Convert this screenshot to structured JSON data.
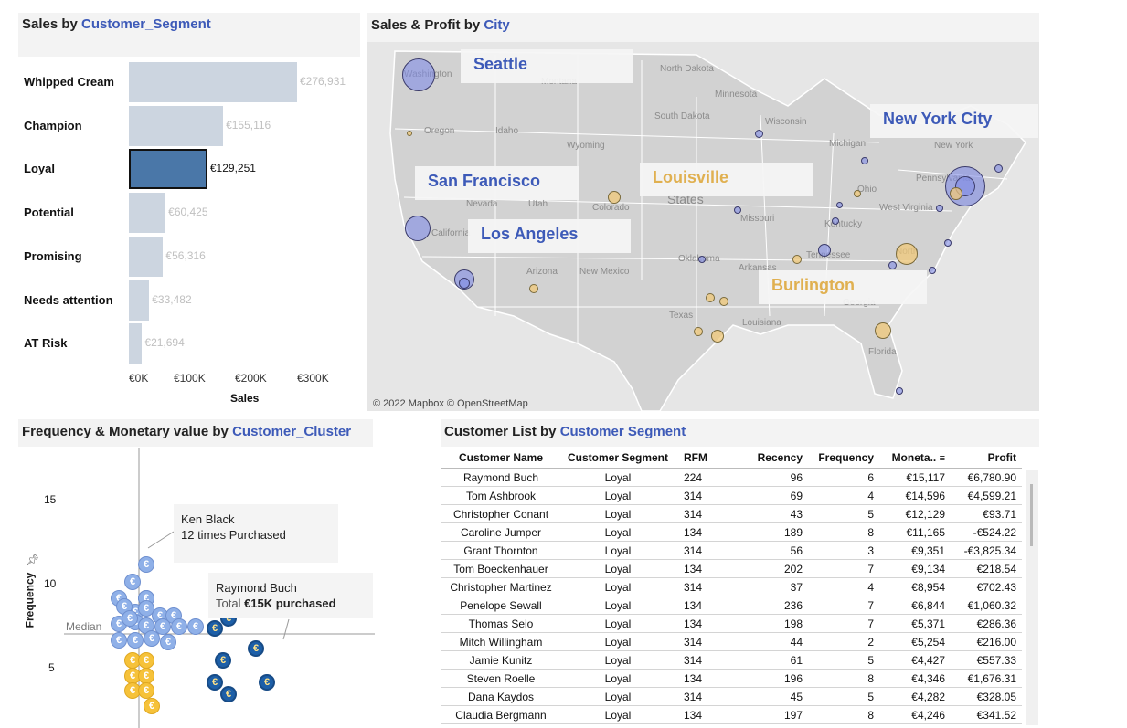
{
  "colors": {
    "accent": "#3d5ab8",
    "bar": "#ccd5e0",
    "bar_selected": "#4a77a8",
    "gold": "#e0b050",
    "coin_light": "#8fb0e8",
    "coin_dark": "#1d5fa8",
    "coin_gold": "#f6c23a"
  },
  "sales_panel": {
    "title_prefix": "Sales by ",
    "title_accent": "Customer_Segment",
    "axis_title": "Sales",
    "ticks": [
      "€0K",
      "€100K",
      "€200K",
      "€300K"
    ]
  },
  "map_panel": {
    "title_prefix": "Sales & Profit by ",
    "title_accent": "City",
    "attribution": "© 2022 Mapbox © OpenStreetMap",
    "state_labels": [
      "Washington",
      "Oregon",
      "Idaho",
      "Montana",
      "North Dakota",
      "South Dakota",
      "Minnesota",
      "Wisconsin",
      "Michigan",
      "New York",
      "Pennsylvania",
      "Ohio",
      "West Virginia",
      "Wyoming",
      "Nevada",
      "Utah",
      "Colorado",
      "California",
      "Arizona",
      "New Mexico",
      "Oklahoma",
      "Arkansas",
      "Texas",
      "Louisiana",
      "Missouri",
      "Kentucky",
      "Tennessee",
      "North",
      "Georgia",
      "Florida",
      "States"
    ],
    "city_callouts": [
      {
        "name": "Seattle",
        "color": "blue"
      },
      {
        "name": "New York City",
        "color": "blue"
      },
      {
        "name": "San Francisco",
        "color": "blue"
      },
      {
        "name": "Louisville",
        "color": "gold"
      },
      {
        "name": "Los Angeles",
        "color": "blue"
      },
      {
        "name": "Burlington",
        "color": "gold"
      }
    ]
  },
  "freq_panel": {
    "title_prefix": "Frequency & Monetary value by ",
    "title_accent": "Customer_Cluster",
    "y_axis_label": "Frequency",
    "y_ticks": [
      "15",
      "10",
      "5"
    ],
    "median_label": "Median",
    "coin_glyph": "€",
    "tooltip1": {
      "line1": "Ken Black",
      "line2": "12 times Purchased"
    },
    "tooltip2": {
      "line1": "Raymond Buch",
      "line2_prefix": "Total ",
      "line2_value": "€15K purchased"
    }
  },
  "table_panel": {
    "title_prefix": "Customer List by ",
    "title_accent": "Customer Segment",
    "columns": [
      "Customer Name",
      "Customer Segment",
      "RFM",
      "Recency",
      "Frequency",
      "Moneta..",
      "Profit"
    ],
    "rows": [
      [
        "Raymond Buch",
        "Loyal",
        "224",
        "96",
        "6",
        "€15,117",
        "€6,780.90"
      ],
      [
        "Tom Ashbrook",
        "Loyal",
        "314",
        "69",
        "4",
        "€14,596",
        "€4,599.21"
      ],
      [
        "Christopher Conant",
        "Loyal",
        "314",
        "43",
        "5",
        "€12,129",
        "€93.71"
      ],
      [
        "Caroline Jumper",
        "Loyal",
        "134",
        "189",
        "8",
        "€11,165",
        "-€524.22"
      ],
      [
        "Grant Thornton",
        "Loyal",
        "314",
        "56",
        "3",
        "€9,351",
        "-€3,825.34"
      ],
      [
        "Tom Boeckenhauer",
        "Loyal",
        "134",
        "202",
        "7",
        "€9,134",
        "€218.54"
      ],
      [
        "Christopher Martinez",
        "Loyal",
        "314",
        "37",
        "4",
        "€8,954",
        "€702.43"
      ],
      [
        "Penelope Sewall",
        "Loyal",
        "134",
        "236",
        "7",
        "€6,844",
        "€1,060.32"
      ],
      [
        "Thomas Seio",
        "Loyal",
        "134",
        "198",
        "7",
        "€5,371",
        "€286.36"
      ],
      [
        "Mitch Willingham",
        "Loyal",
        "314",
        "44",
        "2",
        "€5,254",
        "€216.00"
      ],
      [
        "Jamie Kunitz",
        "Loyal",
        "314",
        "61",
        "5",
        "€4,427",
        "€557.33"
      ],
      [
        "Steven Roelle",
        "Loyal",
        "134",
        "196",
        "8",
        "€4,346",
        "€1,676.31"
      ],
      [
        "Dana Kaydos",
        "Loyal",
        "314",
        "45",
        "5",
        "€4,282",
        "€328.05"
      ],
      [
        "Claudia Bergmann",
        "Loyal",
        "134",
        "197",
        "8",
        "€4,246",
        "€341.52"
      ]
    ]
  },
  "chart_data": [
    {
      "type": "bar",
      "title": "Sales by Customer_Segment",
      "xlabel": "Sales",
      "ylabel": "",
      "categories": [
        "Whipped Cream",
        "Champion",
        "Loyal",
        "Potential",
        "Promising",
        "Needs attention",
        "AT Risk"
      ],
      "values": [
        276931,
        155116,
        129251,
        60425,
        56316,
        33482,
        21694
      ],
      "value_labels": [
        "€276,931",
        "€155,116",
        "€129,251",
        "€60,425",
        "€56,316",
        "€33,482",
        "€21,694"
      ],
      "selected": "Loyal",
      "xlim": [
        0,
        330000
      ]
    },
    {
      "type": "scatter",
      "title": "Frequency & Monetary value by Customer_Cluster",
      "ylabel": "Frequency",
      "ylim": [
        3,
        16
      ],
      "median_frequency": 8,
      "points_light": [
        [
          2,
          12
        ],
        [
          1.5,
          11
        ],
        [
          2,
          10
        ],
        [
          2,
          10
        ],
        [
          1,
          10
        ],
        [
          1.6,
          9.2
        ],
        [
          2,
          9.4
        ],
        [
          2.5,
          9
        ],
        [
          3,
          9
        ],
        [
          1,
          8.5
        ],
        [
          1.6,
          8.6
        ],
        [
          2,
          8.4
        ],
        [
          2.6,
          8.3
        ],
        [
          3.2,
          8.3
        ],
        [
          3.8,
          8.3
        ],
        [
          1,
          7.5
        ],
        [
          1.6,
          7.5
        ],
        [
          2.2,
          7.6
        ],
        [
          2.8,
          7.4
        ],
        [
          1.2,
          9.5
        ],
        [
          1.4,
          8.8
        ]
      ],
      "points_dark": [
        [
          4.5,
          8.2
        ],
        [
          5,
          8.8
        ],
        [
          6,
          7
        ],
        [
          4.8,
          6.3
        ],
        [
          4.5,
          5
        ],
        [
          6.4,
          5
        ],
        [
          5,
          4.3
        ]
      ],
      "points_gold": [
        [
          1.5,
          6.3
        ],
        [
          2,
          6.3
        ],
        [
          1.5,
          5.4
        ],
        [
          2,
          5.4
        ],
        [
          1.5,
          4.5
        ],
        [
          2,
          4.5
        ],
        [
          2.2,
          3.6
        ]
      ]
    }
  ]
}
